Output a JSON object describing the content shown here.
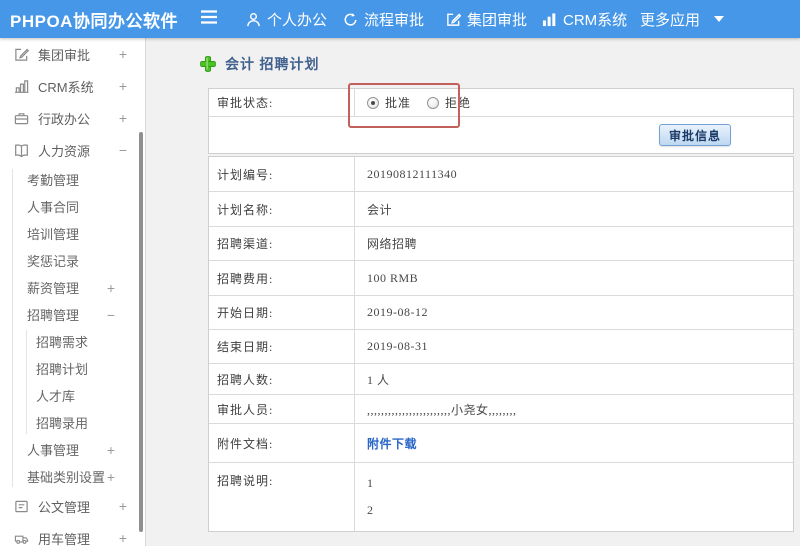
{
  "topbar": {
    "logo": "PHPOA协同办公软件",
    "items": [
      {
        "label": "个人办公"
      },
      {
        "label": "流程审批"
      },
      {
        "label": "集团审批"
      },
      {
        "label": "CRM系统"
      },
      {
        "label": "更多应用"
      }
    ]
  },
  "sidebar": {
    "items": [
      {
        "label": "集团审批",
        "expand": "+"
      },
      {
        "label": "CRM系统",
        "expand": "+"
      },
      {
        "label": "行政办公",
        "expand": "+"
      },
      {
        "label": "人力资源",
        "expand": "−",
        "children": [
          {
            "label": "考勤管理"
          },
          {
            "label": "人事合同"
          },
          {
            "label": "培训管理"
          },
          {
            "label": "奖惩记录"
          },
          {
            "label": "薪资管理",
            "expand": "+"
          },
          {
            "label": "招聘管理",
            "expand": "−",
            "children": [
              {
                "label": "招聘需求"
              },
              {
                "label": "招聘计划"
              },
              {
                "label": "人才库"
              },
              {
                "label": "招聘录用"
              }
            ]
          },
          {
            "label": "人事管理",
            "expand": "+"
          },
          {
            "label": "基础类别设置",
            "expand": "+"
          }
        ]
      },
      {
        "label": "公文管理",
        "expand": "+"
      },
      {
        "label": "用车管理",
        "expand": "+"
      }
    ]
  },
  "main": {
    "title": "会计 招聘计划",
    "approval": {
      "label": "审批状态:",
      "options": [
        {
          "label": "批准",
          "selected": true
        },
        {
          "label": "拒绝",
          "selected": false
        }
      ],
      "button": "审批信息"
    },
    "fields": [
      {
        "label": "计划编号:",
        "value": "20190812111340"
      },
      {
        "label": "计划名称:",
        "value": "会计"
      },
      {
        "label": "招聘渠道:",
        "value": "网络招聘"
      },
      {
        "label": "招聘费用:",
        "value": "100 RMB"
      },
      {
        "label": "开始日期:",
        "value": "2019-08-12"
      },
      {
        "label": "结束日期:",
        "value": "2019-08-31"
      },
      {
        "label": "招聘人数:",
        "value": "1 人"
      },
      {
        "label": "审批人员:",
        "value": ",,,,,,,,,,,,,,,,,,,,,,,,小尧女,,,,,,,,"
      },
      {
        "label": "附件文档:",
        "value": "附件下载"
      },
      {
        "label": "招聘说明:",
        "lines": [
          "1",
          "2"
        ]
      }
    ]
  },
  "colors": {
    "topbar_blue": "#4797e8",
    "highlight_red": "#c4605c",
    "link_blue": "#2a66c8",
    "plus_green": "#4cc027"
  }
}
